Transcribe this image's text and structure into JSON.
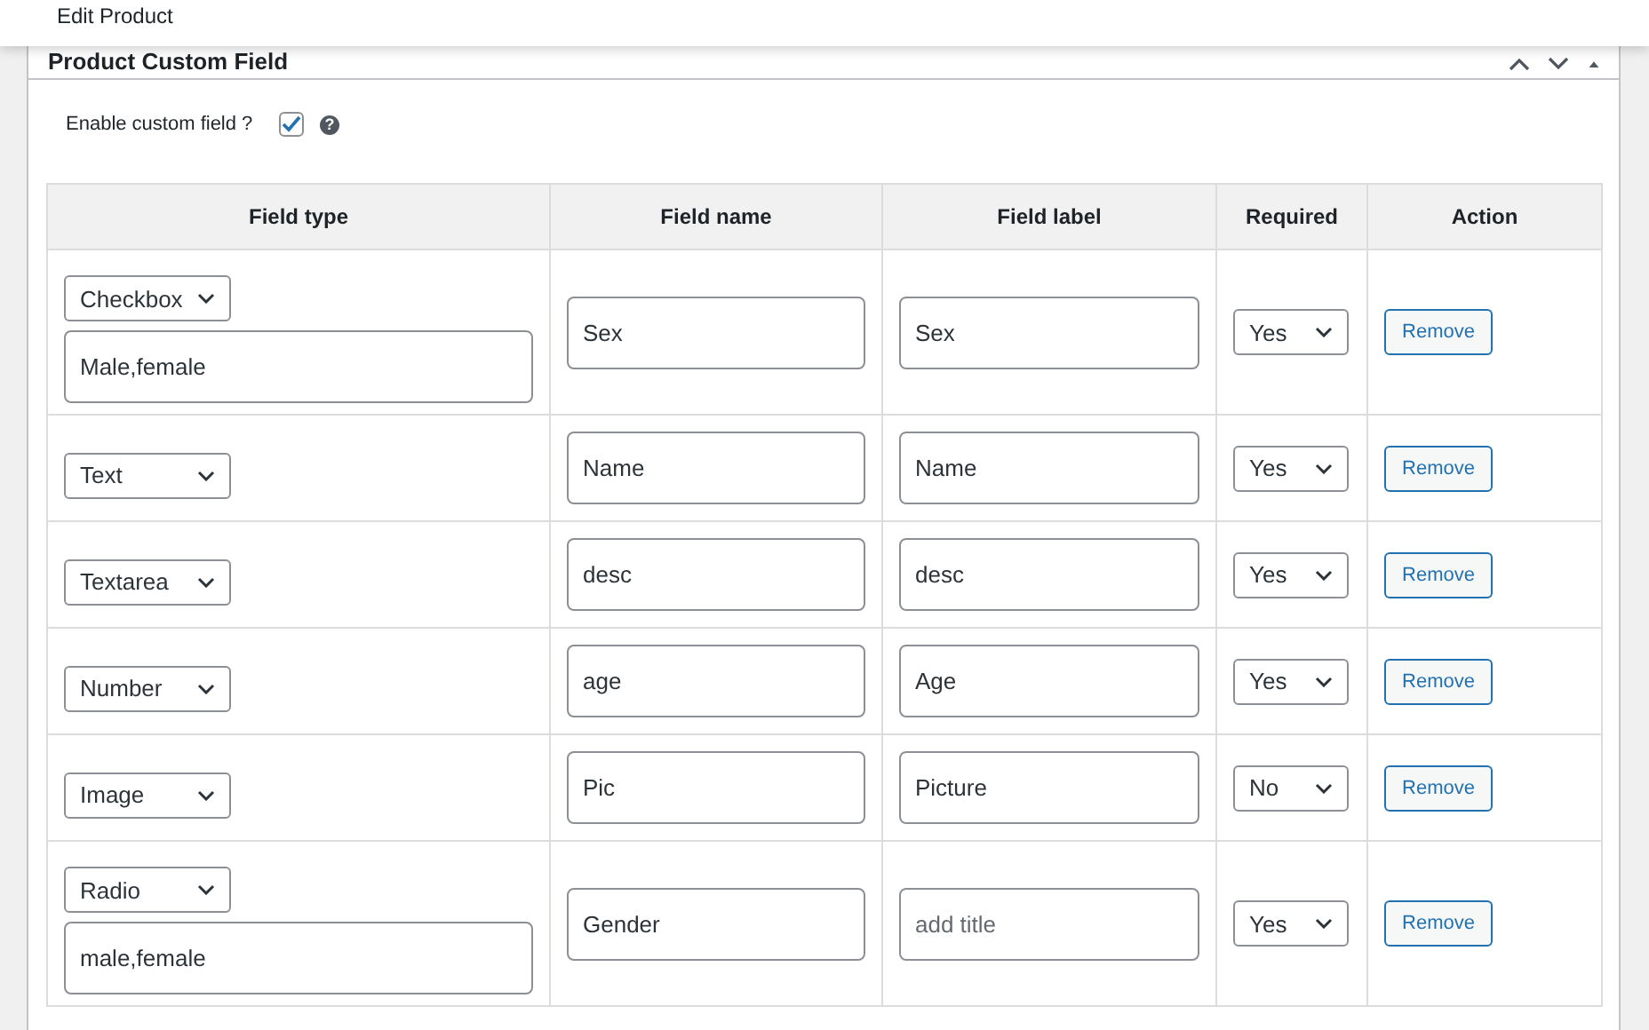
{
  "top_bar": {
    "title": "Edit Product"
  },
  "panel": {
    "title": "Product Custom Field",
    "enable": {
      "label": "Enable custom field ?",
      "checked": true,
      "help": "?"
    }
  },
  "table": {
    "columns": [
      "Field type",
      "Field name",
      "Field label",
      "Required",
      "Action"
    ],
    "rows": [
      {
        "field_type": "Checkbox",
        "options": "Male,female",
        "field_name": "Sex",
        "field_label": {
          "value": "Sex"
        },
        "required": "Yes",
        "action": "Remove"
      },
      {
        "field_type": "Text",
        "field_name": "Name",
        "field_label": {
          "value": "Name"
        },
        "required": "Yes",
        "action": "Remove"
      },
      {
        "field_type": "Textarea",
        "field_name": "desc",
        "field_label": {
          "value": "desc"
        },
        "required": "Yes",
        "action": "Remove"
      },
      {
        "field_type": "Number",
        "field_name": "age",
        "field_label": {
          "value": "Age"
        },
        "required": "Yes",
        "action": "Remove"
      },
      {
        "field_type": "Image",
        "field_name": "Pic",
        "field_label": {
          "value": "Picture"
        },
        "required": "No",
        "action": "Remove"
      },
      {
        "field_type": "Radio",
        "options": "male,female",
        "field_name": "Gender",
        "field_label": {
          "placeholder": "add title"
        },
        "required": "Yes",
        "action": "Remove"
      }
    ]
  }
}
